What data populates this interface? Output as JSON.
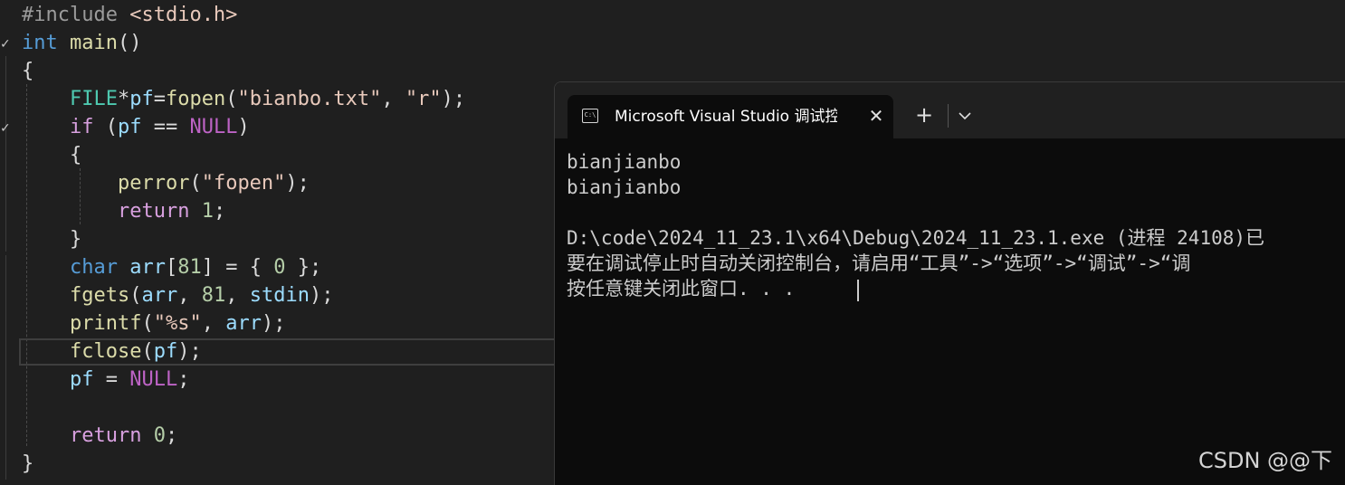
{
  "editor": {
    "lines": [
      {
        "tokens": [
          {
            "t": "#include ",
            "c": "pre"
          },
          {
            "t": "<stdio.h>",
            "c": "str"
          }
        ]
      },
      {
        "tokens": [
          {
            "t": "int",
            "c": "kw"
          },
          {
            "t": " ",
            "c": "pl"
          },
          {
            "t": "main",
            "c": "fn"
          },
          {
            "t": "()",
            "c": "pl"
          }
        ]
      },
      {
        "tokens": [
          {
            "t": "{",
            "c": "pl"
          }
        ]
      },
      {
        "tokens": [
          {
            "t": "    ",
            "c": "pl"
          },
          {
            "t": "FILE",
            "c": "type"
          },
          {
            "t": "*",
            "c": "pl"
          },
          {
            "t": "pf",
            "c": "var"
          },
          {
            "t": "=",
            "c": "pl"
          },
          {
            "t": "fopen",
            "c": "fn"
          },
          {
            "t": "(",
            "c": "pl"
          },
          {
            "t": "\"bianbo.txt\"",
            "c": "str"
          },
          {
            "t": ", ",
            "c": "pl"
          },
          {
            "t": "\"r\"",
            "c": "str"
          },
          {
            "t": ");",
            "c": "pl"
          }
        ]
      },
      {
        "tokens": [
          {
            "t": "    ",
            "c": "pl"
          },
          {
            "t": "if",
            "c": "ctl"
          },
          {
            "t": " (",
            "c": "pl"
          },
          {
            "t": "pf",
            "c": "var"
          },
          {
            "t": " == ",
            "c": "pl"
          },
          {
            "t": "NULL",
            "c": "mac"
          },
          {
            "t": ")",
            "c": "pl"
          }
        ]
      },
      {
        "tokens": [
          {
            "t": "    {",
            "c": "pl"
          }
        ]
      },
      {
        "tokens": [
          {
            "t": "        ",
            "c": "pl"
          },
          {
            "t": "perror",
            "c": "fn"
          },
          {
            "t": "(",
            "c": "pl"
          },
          {
            "t": "\"fopen\"",
            "c": "str"
          },
          {
            "t": ");",
            "c": "pl"
          }
        ]
      },
      {
        "tokens": [
          {
            "t": "        ",
            "c": "pl"
          },
          {
            "t": "return",
            "c": "ctl"
          },
          {
            "t": " ",
            "c": "pl"
          },
          {
            "t": "1",
            "c": "num"
          },
          {
            "t": ";",
            "c": "pl"
          }
        ]
      },
      {
        "tokens": [
          {
            "t": "    }",
            "c": "pl"
          }
        ]
      },
      {
        "tokens": [
          {
            "t": "    ",
            "c": "pl"
          },
          {
            "t": "char",
            "c": "kw"
          },
          {
            "t": " ",
            "c": "pl"
          },
          {
            "t": "arr",
            "c": "var"
          },
          {
            "t": "[",
            "c": "pl"
          },
          {
            "t": "81",
            "c": "num"
          },
          {
            "t": "] = { ",
            "c": "pl"
          },
          {
            "t": "0",
            "c": "num"
          },
          {
            "t": " };",
            "c": "pl"
          }
        ]
      },
      {
        "tokens": [
          {
            "t": "    ",
            "c": "pl"
          },
          {
            "t": "fgets",
            "c": "fn"
          },
          {
            "t": "(",
            "c": "pl"
          },
          {
            "t": "arr",
            "c": "var"
          },
          {
            "t": ", ",
            "c": "pl"
          },
          {
            "t": "81",
            "c": "num"
          },
          {
            "t": ", ",
            "c": "pl"
          },
          {
            "t": "stdin",
            "c": "var"
          },
          {
            "t": ");",
            "c": "pl"
          }
        ]
      },
      {
        "tokens": [
          {
            "t": "    ",
            "c": "pl"
          },
          {
            "t": "printf",
            "c": "fn"
          },
          {
            "t": "(",
            "c": "pl"
          },
          {
            "t": "\"%s\"",
            "c": "str"
          },
          {
            "t": ", ",
            "c": "pl"
          },
          {
            "t": "arr",
            "c": "var"
          },
          {
            "t": ");",
            "c": "pl"
          }
        ]
      },
      {
        "tokens": [
          {
            "t": "    ",
            "c": "pl"
          },
          {
            "t": "fclose",
            "c": "fn"
          },
          {
            "t": "(",
            "c": "pl"
          },
          {
            "t": "pf",
            "c": "var"
          },
          {
            "t": ");",
            "c": "pl"
          }
        ]
      },
      {
        "tokens": [
          {
            "t": "    ",
            "c": "pl"
          },
          {
            "t": "pf",
            "c": "var"
          },
          {
            "t": " = ",
            "c": "pl"
          },
          {
            "t": "NULL",
            "c": "mac"
          },
          {
            "t": ";",
            "c": "pl"
          }
        ]
      },
      {
        "tokens": [
          {
            "t": "",
            "c": "pl"
          }
        ]
      },
      {
        "tokens": [
          {
            "t": "    ",
            "c": "pl"
          },
          {
            "t": "return",
            "c": "ctl"
          },
          {
            "t": " ",
            "c": "pl"
          },
          {
            "t": "0",
            "c": "num"
          },
          {
            "t": ";",
            "c": "pl"
          }
        ]
      },
      {
        "tokens": [
          {
            "t": "}",
            "c": "pl"
          }
        ]
      }
    ],
    "fold_marks": [
      "✓",
      "✓"
    ]
  },
  "terminal": {
    "tab": {
      "icon": "terminal-icon",
      "icon_text": "C:\\",
      "title": "Microsoft Visual Studio 调试控制台",
      "close_glyph": "✕"
    },
    "new_tab_glyph": "+",
    "dropdown_icon": "chevron-down-icon",
    "output": [
      "bianjianbo",
      "bianjianbo",
      "",
      "D:\\code\\2024_11_23.1\\x64\\Debug\\2024_11_23.1.exe (进程 24108)已",
      "要在调试停止时自动关闭控制台，请启用“工具”->“选项”->“调试”->“调",
      "按任意键关闭此窗口. . ."
    ]
  },
  "watermark": "CSDN @@下"
}
